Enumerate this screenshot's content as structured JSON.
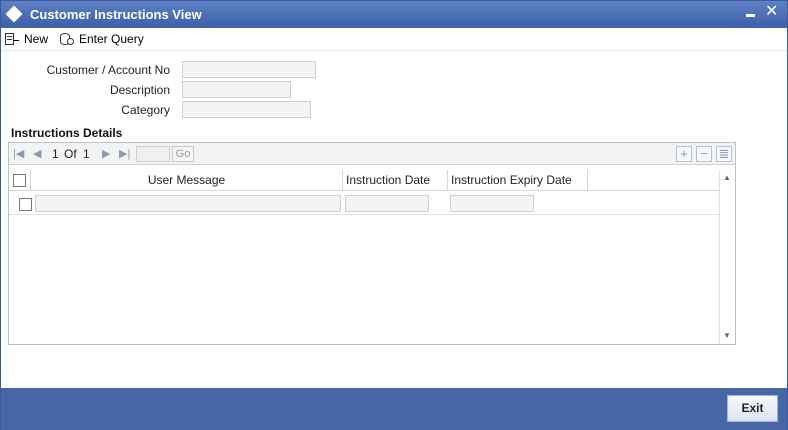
{
  "window": {
    "title": "Customer Instructions View"
  },
  "toolbar": {
    "new_label": "New",
    "enter_query_label": "Enter Query"
  },
  "form": {
    "customer_account_label": "Customer / Account No",
    "customer_account_value": "",
    "description_label": "Description",
    "description_value": "",
    "category_label": "Category",
    "category_value": ""
  },
  "section": {
    "title": "Instructions Details"
  },
  "pager": {
    "current": "1",
    "of_label": "Of",
    "total": "1",
    "go_label": "Go",
    "page_input": ""
  },
  "grid": {
    "columns": [
      "User Message",
      "Instruction Date",
      "Instruction Expiry Date"
    ],
    "rows": [
      {
        "user_message": "",
        "instruction_date": "",
        "instruction_expiry_date": ""
      }
    ]
  },
  "footer": {
    "exit_label": "Exit"
  },
  "colors": {
    "titlebar": "#3d5fa8",
    "footer": "#4865a6",
    "field_bg": "#f4f4f4"
  }
}
